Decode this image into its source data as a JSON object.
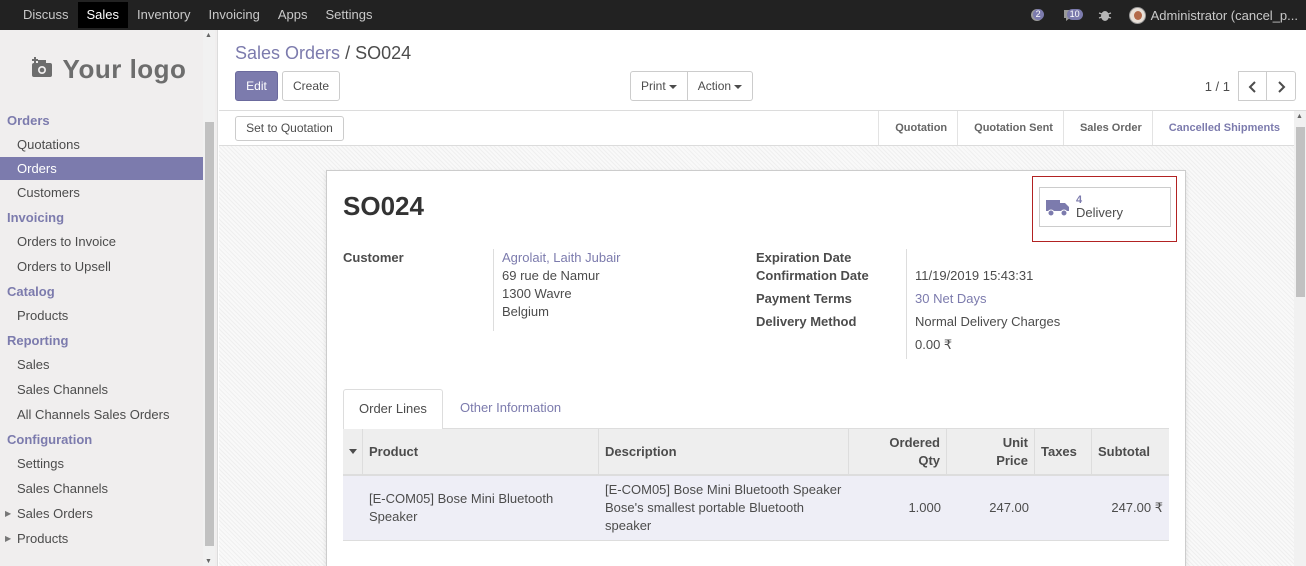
{
  "topbar": {
    "menu": [
      "Discuss",
      "Sales",
      "Inventory",
      "Invoicing",
      "Apps",
      "Settings"
    ],
    "active_index": 1,
    "chat_count": "2",
    "activity_count": "10",
    "user": "Administrator (cancel_p..."
  },
  "sidebar": {
    "logo_text": "Your logo",
    "sections": [
      {
        "title": "Orders",
        "items": [
          "Quotations",
          "Orders",
          "Customers"
        ]
      },
      {
        "title": "Invoicing",
        "items": [
          "Orders to Invoice",
          "Orders to Upsell"
        ]
      },
      {
        "title": "Catalog",
        "items": [
          "Products"
        ]
      },
      {
        "title": "Reporting",
        "items": [
          "Sales",
          "Sales Channels",
          "All Channels Sales Orders"
        ]
      },
      {
        "title": "Configuration",
        "items": [
          "Settings",
          "Sales Channels",
          "Sales Orders",
          "Products"
        ]
      }
    ],
    "active_item": "Orders"
  },
  "control_panel": {
    "breadcrumb_parent": "Sales Orders",
    "breadcrumb_sep": "/",
    "breadcrumb_current": "SO024",
    "edit_label": "Edit",
    "create_label": "Create",
    "print_label": "Print",
    "action_label": "Action",
    "pager": "1 / 1"
  },
  "statusbar": {
    "set_to_quotation_label": "Set to Quotation",
    "stages": [
      "Quotation",
      "Quotation Sent",
      "Sales Order",
      "Cancelled Shipments"
    ],
    "current_stage": "Cancelled Shipments"
  },
  "form": {
    "name": "SO024",
    "smart_button": {
      "count": "4",
      "label": "Delivery"
    },
    "customer_label": "Customer",
    "customer_name": "Agrolait, Laith Jubair",
    "address_line1": "69 rue de Namur",
    "address_line2": "1300 Wavre",
    "address_line3": "Belgium",
    "expiration_date_label": "Expiration Date",
    "expiration_date_value": "",
    "confirmation_date_label": "Confirmation Date",
    "confirmation_date_value": "11/19/2019 15:43:31",
    "payment_terms_label": "Payment Terms",
    "payment_terms_value": "30 Net Days",
    "delivery_method_label": "Delivery Method",
    "delivery_method_value": "Normal Delivery Charges",
    "delivery_price": "0.00 ₹",
    "tabs": [
      "Order Lines",
      "Other Information"
    ],
    "columns": {
      "product": "Product",
      "description": "Description",
      "ordered_qty_1": "Ordered",
      "ordered_qty_2": "Qty",
      "unit_price_1": "Unit",
      "unit_price_2": "Price",
      "taxes": "Taxes",
      "subtotal": "Subtotal"
    },
    "lines": [
      {
        "product": "[E-COM05] Bose Mini Bluetooth Speaker",
        "description": "[E-COM05] Bose Mini Bluetooth Speaker Bose's smallest portable Bluetooth speaker",
        "ordered_qty": "1.000",
        "unit_price": "247.00",
        "taxes": "",
        "subtotal": "247.00 ₹"
      }
    ]
  },
  "colors": {
    "topbar": "#222222",
    "accent": "#7c7bad",
    "sidebar_bg": "#f0eeee",
    "highlight_border": "#b22222"
  },
  "icons": {
    "chat": "chat-icon",
    "activity": "activity-icon",
    "debug": "bug-icon",
    "logo": "camera-plus-icon",
    "delivery": "truck-icon",
    "prev": "chevron-left-icon",
    "next": "chevron-right-icon"
  }
}
